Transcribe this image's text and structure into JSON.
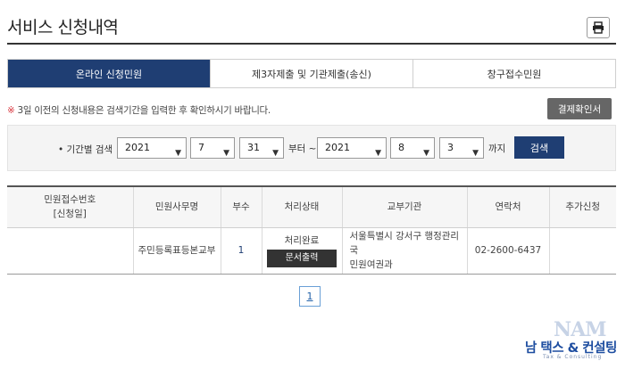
{
  "page": {
    "title": "서비스 신청내역"
  },
  "icons": {
    "print": "printer-icon"
  },
  "tabs": [
    {
      "label": "온라인 신청민원",
      "active": true
    },
    {
      "label": "제3자제출 및 기관제출(송신)",
      "active": false
    },
    {
      "label": "창구접수민원",
      "active": false
    }
  ],
  "notice": {
    "mark": "※",
    "text": "3일 이전의 신청내용은 검색기간을 입력한 후 확인하시기 바랍니다."
  },
  "confirm_button": "결제확인서",
  "search": {
    "label": "기간별 검색",
    "from_year": "2021",
    "from_month": "7",
    "from_day": "31",
    "from_suffix": "부터 ~",
    "to_year": "2021",
    "to_month": "8",
    "to_day": "3",
    "to_suffix": "까지",
    "button": "검색"
  },
  "table": {
    "headers": {
      "receipt_no": "민원접수번호",
      "receipt_date": "[신청일]",
      "service_name": "민원사무명",
      "count": "부수",
      "status": "처리상태",
      "agency": "교부기관",
      "contact": "연락처",
      "extra": "추가신청"
    },
    "rows": [
      {
        "receipt": "",
        "service_name": "주민등록표등본교부",
        "count": "1",
        "status": "처리완료",
        "print_button": "문서출력",
        "agency_line1": "서울특별시 강서구 행정관리국",
        "agency_line2": "민원여권과",
        "contact": "02-2600-6437",
        "extra": ""
      }
    ]
  },
  "pagination": {
    "current": "1"
  },
  "logo": {
    "mark": "NAM",
    "name": "남 택스 & 컨설팅",
    "sub": "Tax & Consulting"
  }
}
